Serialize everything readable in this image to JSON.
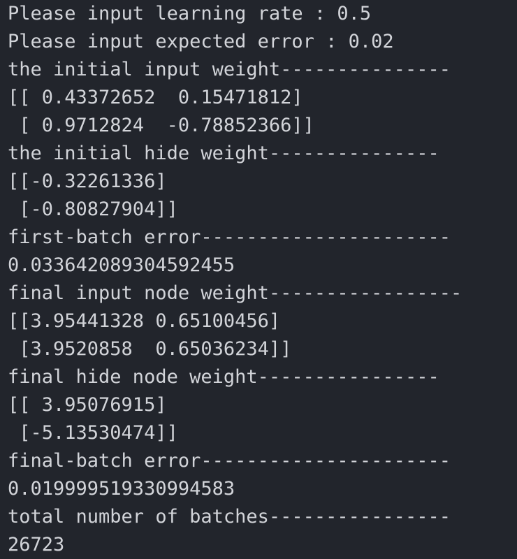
{
  "terminal": {
    "lines": [
      "Please input learning rate : 0.5",
      "Please input expected error : 0.02",
      "the initial input weight---------------",
      "[[ 0.43372652  0.15471812]",
      " [ 0.9712824  -0.78852366]]",
      "the initial hide weight---------------",
      "[[-0.32261336]",
      " [-0.80827904]]",
      "first-batch error----------------------",
      "0.033642089304592455",
      "final input node weight-----------------",
      "[[3.95441328 0.65100456]",
      " [3.9520858  0.65036234]]",
      "final hide node weight----------------",
      "[[ 3.95076915]",
      " [-5.13530474]]",
      "final-batch error----------------------",
      "0.019999519330994583",
      "total number of batches----------------",
      "26723"
    ]
  },
  "colors": {
    "background": "#22252c",
    "text": "#d2d4d9"
  }
}
